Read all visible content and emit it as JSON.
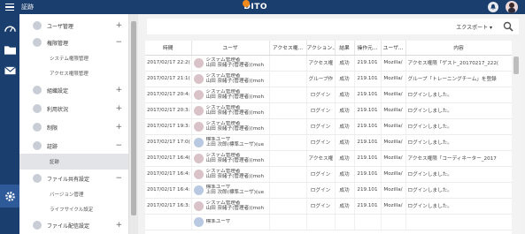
{
  "header": {
    "title": "証跡",
    "logo_text": "DITO"
  },
  "rail": {
    "icons": [
      "dashboard-icon",
      "folder-icon",
      "mail-icon",
      "gear-icon"
    ]
  },
  "menu": {
    "items": [
      {
        "label": "ユーザ管理",
        "has_plus": true
      },
      {
        "label": "権限管理",
        "has_plus": false,
        "expanded": true
      },
      {
        "label": "システム権限管理",
        "sub": true
      },
      {
        "label": "アクセス権限管理",
        "sub": true
      },
      {
        "label": "組織設定",
        "has_plus": true
      },
      {
        "label": "利用状況",
        "has_plus": true
      },
      {
        "label": "制限",
        "has_plus": true
      },
      {
        "label": "証跡",
        "has_plus": false,
        "expanded": true
      },
      {
        "label": "証跡",
        "sub": true,
        "active": true
      },
      {
        "label": "ファイル共有設定",
        "has_plus": false,
        "expanded": true
      },
      {
        "label": "バージョン管理",
        "sub": true
      },
      {
        "label": "ライフサイクル設定",
        "sub": true
      },
      {
        "label": "ファイル配信設定",
        "has_plus": true
      }
    ],
    "plus_symbol": "+",
    "minus_symbol": "−"
  },
  "toolbar": {
    "export_label": "エクスポート ▾"
  },
  "table": {
    "columns": [
      "時間",
      "ユーザ",
      "アクセス権...",
      "アクション...",
      "結果",
      "操作元...",
      "ユーザ...",
      "内容"
    ],
    "rows": [
      {
        "time": "2017/02/17 22:2(",
        "user_title": "システム管理者",
        "user_name": "山田 奈緒子(管理者)(moh",
        "access": "",
        "action": "アクセス権",
        "result": "成功",
        "ip": "219.101",
        "agent": "Mozilla/",
        "content": "アクセス権限「ゲスト_20170217_222(",
        "alt": false
      },
      {
        "time": "2017/02/17 21:1(",
        "user_title": "システム管理者",
        "user_name": "山田 奈緒子(管理者)(moh",
        "access": "",
        "action": "グループ作",
        "result": "成功",
        "ip": "219.101",
        "agent": "Mozilla/",
        "content": "グループ「トレーニングチーム」を登録",
        "alt": false
      },
      {
        "time": "2017/02/17 20:4:",
        "user_title": "システム管理者",
        "user_name": "山田 奈緒子(管理者)(moh",
        "access": "",
        "action": "ログイン",
        "result": "成功",
        "ip": "219.101",
        "agent": "Mozilla/",
        "content": "ログインしました。",
        "alt": false
      },
      {
        "time": "2017/02/17 20:3:",
        "user_title": "システム管理者",
        "user_name": "山田 奈緒子(管理者)(moh",
        "access": "",
        "action": "ログイン",
        "result": "成功",
        "ip": "219.101",
        "agent": "Mozilla/",
        "content": "ログインしました。",
        "alt": false
      },
      {
        "time": "2017/02/17 19:3:",
        "user_title": "システム管理者",
        "user_name": "山田 奈緒子(管理者)(moh",
        "access": "",
        "action": "ログイン",
        "result": "成功",
        "ip": "219.101",
        "agent": "Mozilla/",
        "content": "ログインしました。",
        "alt": false
      },
      {
        "time": "2017/02/17 17:0(",
        "user_title": "標準ユーザ",
        "user_name": "上田 次郎(標準ユーザ)(ue",
        "access": "",
        "action": "ログイン",
        "result": "成功",
        "ip": "219.101",
        "agent": "Mozilla/",
        "content": "ログインしました。",
        "alt": true
      },
      {
        "time": "2017/02/17 16:4(",
        "user_title": "システム管理者",
        "user_name": "山田 奈緒子(管理者)(moh",
        "access": "",
        "action": "アクセス権",
        "result": "成功",
        "ip": "219.101",
        "agent": "Mozilla/",
        "content": "アクセス権限「コーディネーター_2017",
        "alt": false
      },
      {
        "time": "2017/02/17 16:4:",
        "user_title": "システム管理者",
        "user_name": "山田 奈緒子(管理者)(moh",
        "access": "",
        "action": "ログイン",
        "result": "成功",
        "ip": "219.101",
        "agent": "Mozilla/",
        "content": "ログインしました。",
        "alt": false
      },
      {
        "time": "2017/02/17 16:4:",
        "user_title": "標準ユーザ",
        "user_name": "上田 次郎(標準ユーザ)(ue",
        "access": "",
        "action": "ログイン",
        "result": "成功",
        "ip": "219.101",
        "agent": "Mozilla/",
        "content": "ログインしました。",
        "alt": true
      },
      {
        "time": "2017/02/17 16:3:",
        "user_title": "システム管理者",
        "user_name": "山田 奈緒子(管理者)(moh",
        "access": "",
        "action": "ログイン",
        "result": "成功",
        "ip": "219.101",
        "agent": "Mozilla/",
        "content": "ログインしました。",
        "alt": false
      },
      {
        "time": "",
        "user_title": "標準ユーザ",
        "user_name": "",
        "access": "",
        "action": "",
        "result": "",
        "ip": "",
        "agent": "",
        "content": "",
        "alt": true
      }
    ]
  },
  "colors": {
    "header_bg": "#1a3e6e",
    "rail_active": "#2e5a9a",
    "logo_accent": "#f08a1c",
    "content_bg": "#f2f2f2"
  }
}
